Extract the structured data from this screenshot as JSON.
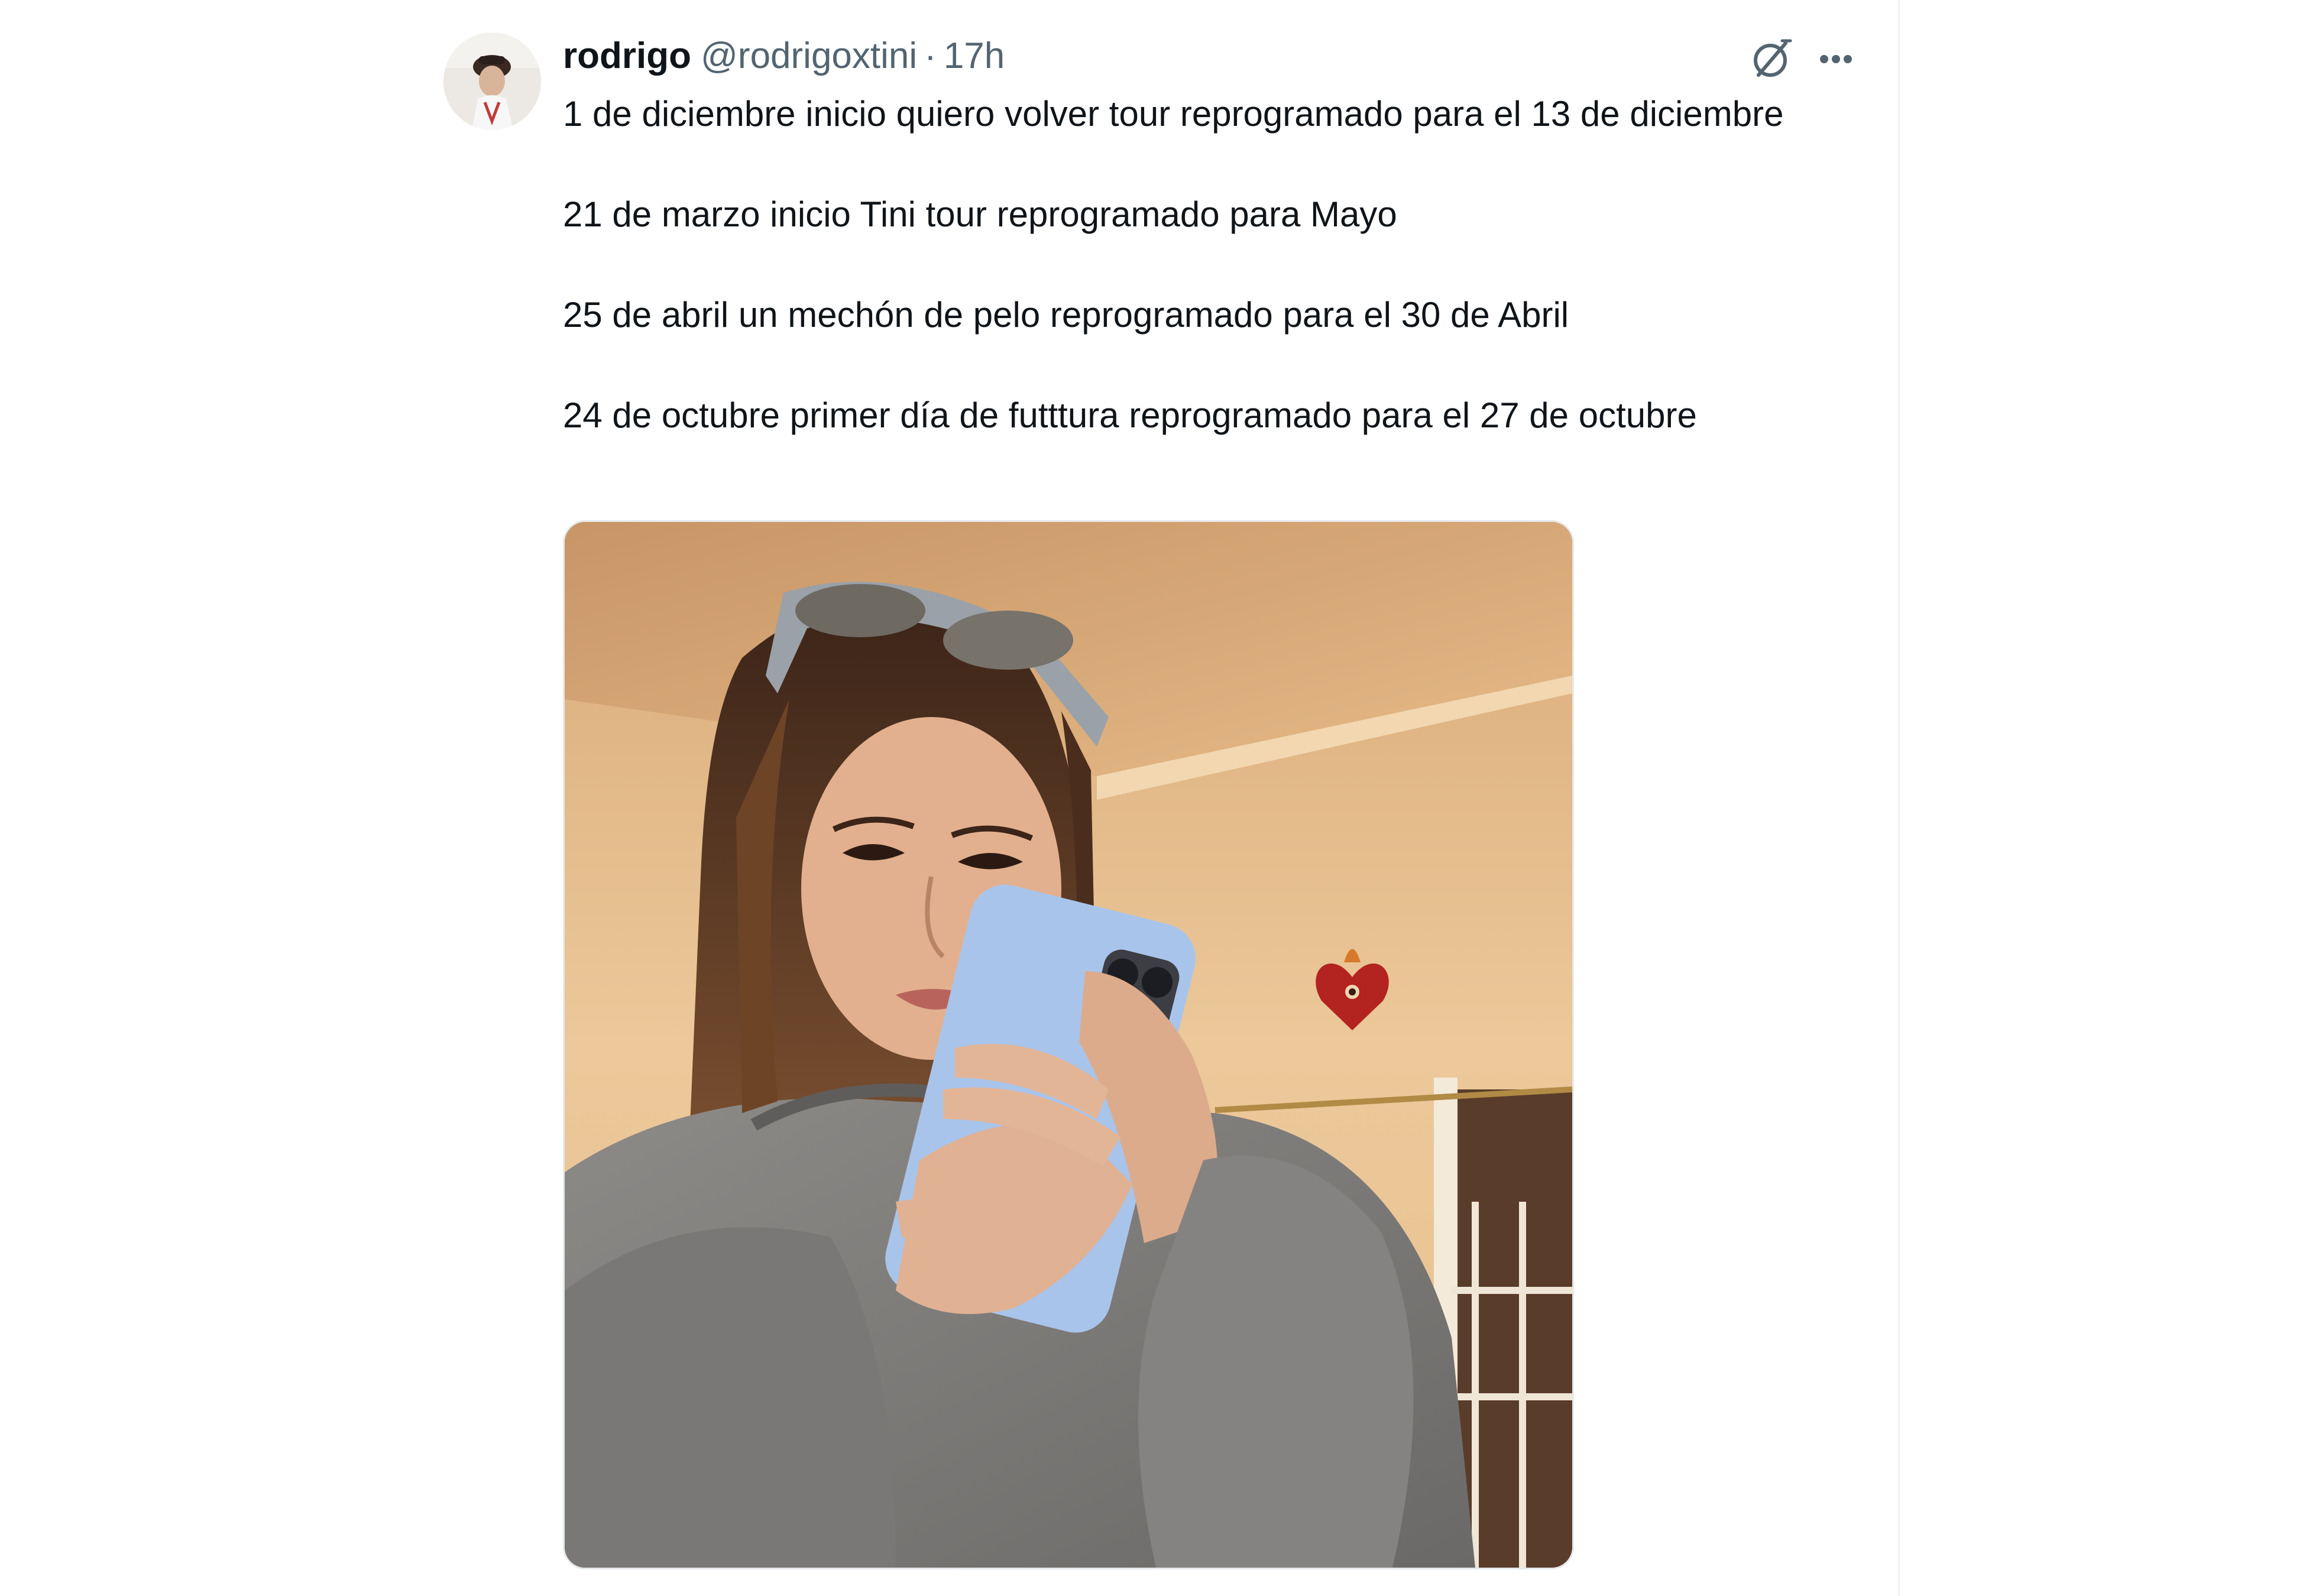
{
  "tweet": {
    "author": {
      "display_name": "rodrigo",
      "handle": "@rodrigoxtini",
      "separator": "·",
      "timestamp": "17h"
    },
    "text_paragraphs": [
      "1 de diciembre inicio quiero volver tour reprogramado para el 13 de diciembre",
      "21 de marzo inicio Tini tour reprogramado para Mayo",
      "25 de abril un mechón de pelo reprogramado para el 30 de Abril",
      "24 de octubre primer día de futttura reprogramado para el 27 de octubre"
    ],
    "icons": {
      "grok": "grok-icon",
      "more": "more-icon"
    }
  },
  "colors": {
    "text_primary": "#0f1419",
    "text_secondary": "#536471",
    "border": "#eff3f4",
    "phone_case": "#a9c4ea"
  }
}
